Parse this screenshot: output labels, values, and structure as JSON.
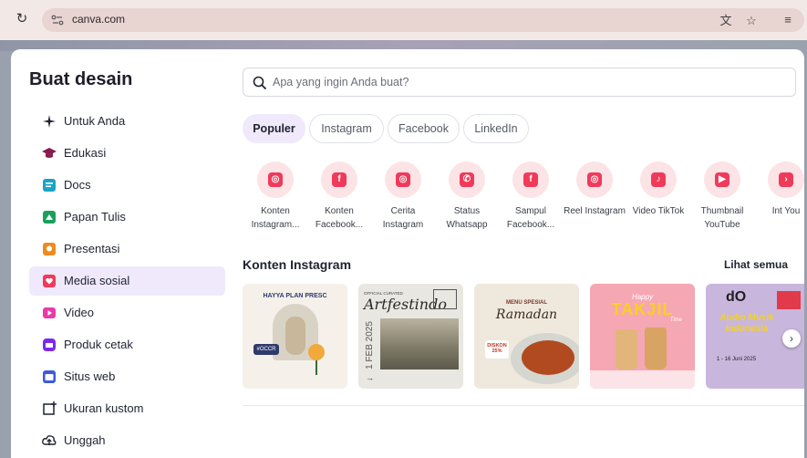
{
  "browser": {
    "url": "canva.com",
    "reload_icon": "reload-icon",
    "translate_icon": "translate-icon",
    "star_icon": "bookmark-star-icon",
    "media_icon": "media-control-icon"
  },
  "dialog": {
    "title": "Buat desain",
    "nav": [
      {
        "label": "Untuk Anda",
        "icon": "sparkle-icon"
      },
      {
        "label": "Edukasi",
        "icon": "graduation-cap-icon"
      },
      {
        "label": "Docs",
        "icon": "docs-icon"
      },
      {
        "label": "Papan Tulis",
        "icon": "whiteboard-icon"
      },
      {
        "label": "Presentasi",
        "icon": "presentation-icon"
      },
      {
        "label": "Media sosial",
        "icon": "social-media-icon",
        "active": true
      },
      {
        "label": "Video",
        "icon": "video-icon"
      },
      {
        "label": "Produk cetak",
        "icon": "print-icon"
      },
      {
        "label": "Situs web",
        "icon": "website-icon"
      },
      {
        "label": "Ukuran kustom",
        "icon": "custom-size-icon"
      },
      {
        "label": "Unggah",
        "icon": "upload-icon"
      }
    ],
    "search": {
      "placeholder": "Apa yang ingin Anda buat?"
    },
    "chips": [
      {
        "label": "Populer",
        "active": true
      },
      {
        "label": "Instagram"
      },
      {
        "label": "Facebook"
      },
      {
        "label": "LinkedIn"
      }
    ],
    "categories": [
      {
        "label": "Konten Instagram...",
        "icon": "instagram-icon"
      },
      {
        "label": "Konten Facebook...",
        "icon": "facebook-icon"
      },
      {
        "label": "Cerita Instagram",
        "icon": "instagram-icon"
      },
      {
        "label": "Status Whatsapp",
        "icon": "whatsapp-icon"
      },
      {
        "label": "Sampul Facebook...",
        "icon": "facebook-icon"
      },
      {
        "label": "Reel Instagram",
        "icon": "instagram-icon"
      },
      {
        "label": "Video TikTok",
        "icon": "tiktok-icon"
      },
      {
        "label": "Thumbnail YouTube",
        "icon": "youtube-icon"
      },
      {
        "label": "Int You",
        "icon": "chevron-right-icon"
      }
    ],
    "section": {
      "title": "Konten Instagram",
      "see_all": "Lihat semua"
    },
    "templates": [
      {
        "text_1": "HAYYA PLAN PRESC",
        "text_2": "#OCCR",
        "bg": "#f5f1ea"
      },
      {
        "text_1": "OFFICIAL CURATED",
        "text_2": "Artfestindo",
        "text_3": "1 FEB 2025",
        "bg": "#e9e7e1"
      },
      {
        "text_1": "MENU SPESIAL",
        "text_2": "Ramadan",
        "text_3": "DISKON 25%",
        "bg": "#efe8dc"
      },
      {
        "text_1": "Happy",
        "text_2": "TAKJIL",
        "text_3": "Time",
        "bg": "#f6a7b4"
      },
      {
        "text_1": "dO",
        "text_2": "Audio Musik Indonesia",
        "text_3": "1 - 16 Juni 2025",
        "bg": "#c9b6dc"
      }
    ],
    "colors": {
      "accent": "#7d2ae8",
      "active_bg": "#efe9fb",
      "social_red": "#f03a5a"
    }
  }
}
